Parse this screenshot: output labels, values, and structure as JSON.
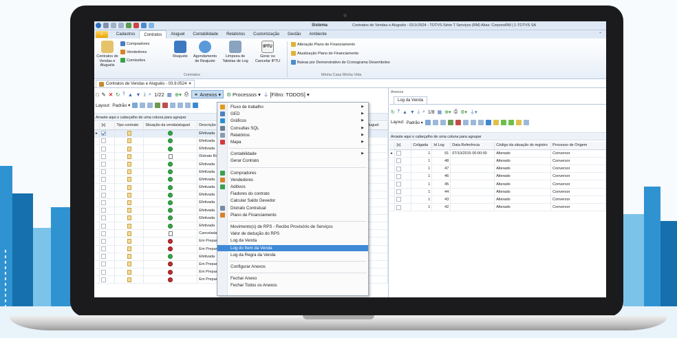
{
  "window": {
    "title": "Sistema",
    "info": "Contratos de Vendas e Aluguéis - 03.9.0524 - TOTVS Série T Serviços (RM) Alias: CorporeRM | 1-TOTVS SA"
  },
  "menu": {
    "tabs": [
      "Cadastros",
      "Contratos",
      "Aluguel",
      "Contabilidade",
      "Relatórios",
      "Customização",
      "Gestão",
      "Ambiente"
    ],
    "active_index": 1
  },
  "ribbon": {
    "big_buttons": [
      {
        "label1": "Contratos de",
        "label2": "Vendas e Aluguéis"
      },
      {
        "label1": "Reajuste",
        "label2": ""
      },
      {
        "label1": "Agendamento",
        "label2": "de Reajuste"
      },
      {
        "label1": "Limpeza de",
        "label2": "Tabelas de Log"
      },
      {
        "label1": "Gerar ou",
        "label2": "Cancelar IPTU"
      }
    ],
    "iptu_icon_text": "IPTU",
    "small_buttons": [
      "Compradores",
      "Vendedores",
      "Comissões"
    ],
    "list_buttons": [
      "Alteração Plano de Financiamento",
      "Atualização Plano de Financiamento",
      "Baixas por Demonstrativo de Cronograma Desembolso"
    ],
    "group_contratos": "Contratos",
    "group_minha_casa": "Minha Casa Minha Vida"
  },
  "doc_tab": "Contratos de Vendas e Aluguéis - 03.9.0524",
  "left": {
    "page_counter": "1/22",
    "anexos": "Anexos",
    "processos": "Processos",
    "filtro": "[Filtro: TODOS]",
    "layout_label": "Layout:",
    "layout_value": "Padrão",
    "group_hint": "Arraste aqui o cabeçalho de uma coluna para agrupar",
    "columns": [
      "[x]",
      "Tipo contrato",
      "Situação da venda/aluguel",
      "Descrição situação",
      "Venda/Aluguel"
    ],
    "rows": [
      {
        "status": "ok",
        "desc": "Efetivada",
        "checked": true
      },
      {
        "status": "ok",
        "desc": "Efetivada",
        "checked": false
      },
      {
        "status": "ok",
        "desc": "Efetivada",
        "checked": false
      },
      {
        "status": "page",
        "desc": "Distrato Bilateral",
        "checked": false
      },
      {
        "status": "ok",
        "desc": "Efetivada",
        "checked": false
      },
      {
        "status": "ok",
        "desc": "Efetivada",
        "checked": false
      },
      {
        "status": "ok",
        "desc": "Efetivada",
        "checked": false
      },
      {
        "status": "ok",
        "desc": "Efetivada",
        "checked": false
      },
      {
        "status": "ok",
        "desc": "Efetivada",
        "checked": false
      },
      {
        "status": "ok",
        "desc": "Efetivada",
        "checked": false
      },
      {
        "status": "ok",
        "desc": "Efetivada",
        "checked": false
      },
      {
        "status": "ok",
        "desc": "Efetivada",
        "checked": false
      },
      {
        "status": "ok",
        "desc": "Efetivada",
        "checked": false
      },
      {
        "status": "page",
        "desc": "Cancelada",
        "checked": false
      },
      {
        "status": "bad",
        "desc": "Em Preparação",
        "checked": false
      },
      {
        "status": "bad",
        "desc": "Em Preparação",
        "checked": false
      },
      {
        "status": "ok",
        "desc": "Efetivada",
        "checked": false
      },
      {
        "status": "bad",
        "desc": "Em Preparação",
        "checked": false
      },
      {
        "status": "bad",
        "desc": "Em Preparação",
        "checked": false
      },
      {
        "status": "bad",
        "desc": "Em Preparação",
        "checked": false
      }
    ]
  },
  "dropdown": {
    "items": [
      {
        "label": "Fluxo de trabalho",
        "icon": "workflow-icon",
        "arrow": true,
        "color": "#e09a1b"
      },
      {
        "label": "GED",
        "icon": "ged-icon",
        "arrow": true,
        "color": "#4f7fc1"
      },
      {
        "label": "Gráficos",
        "icon": "chart-icon",
        "arrow": true,
        "color": "#2d8fd3"
      },
      {
        "label": "Consultas SQL",
        "icon": "sql-icon",
        "arrow": true,
        "color": "#6a7d93"
      },
      {
        "label": "Relatórios",
        "icon": "report-icon",
        "arrow": true,
        "color": "#8a9bb0"
      },
      {
        "label": "Mapa",
        "icon": "map-pin-icon",
        "arrow": true,
        "color": "#d13a3a"
      },
      {
        "sep": true
      },
      {
        "label": "Contabilidade",
        "arrow": true
      },
      {
        "label": "Gerar Contrato"
      },
      {
        "sep": true
      },
      {
        "label": "Compradores",
        "icon": "buyers-icon",
        "color": "#3aa14b"
      },
      {
        "label": "Vendedores",
        "icon": "sellers-icon",
        "color": "#d9822b"
      },
      {
        "label": "Aditivos",
        "icon": "addendum-icon",
        "color": "#3aa14b"
      },
      {
        "label": "Fiadores do contrato"
      },
      {
        "label": "Calcular Saldo Devedor"
      },
      {
        "label": "Distrato Contratual",
        "icon": "document-icon",
        "color": "#7a8aa0"
      },
      {
        "label": "Plano de Financiamento",
        "icon": "finance-icon",
        "color": "#d9822b"
      },
      {
        "sep": true
      },
      {
        "label": "Movimento(s) de RPS - Recibo Provisório de Serviços"
      },
      {
        "label": "Valor de dedução do RPS"
      },
      {
        "label": "Log da Venda"
      },
      {
        "label": "Log do Item da Venda",
        "highlight": true
      },
      {
        "label": "Log da Regra da Venda"
      },
      {
        "sep": true
      },
      {
        "label": "Configurar Anexos"
      },
      {
        "sep": true
      },
      {
        "label": "Fechar Anexo"
      },
      {
        "label": "Fechar Todos os Anexos"
      }
    ]
  },
  "right": {
    "title": "Anexos",
    "tab": "Log da Venda",
    "page_counter": "1/8",
    "layout_label": "Layout:",
    "layout_value": "Padrão",
    "group_hint": "Arraste aqui o cabeçalho de uma coluna para agrupar",
    "columns": [
      "[x]",
      "Coligada",
      "Id Log",
      "Data Referência",
      "Código da situação do registro",
      "Processo de Origem"
    ],
    "rows": [
      {
        "coligada": "1",
        "idlog": "91",
        "data": "07/10/2015 00:00:00",
        "codigo": "Alterado",
        "processo": "Conversor"
      },
      {
        "coligada": "1",
        "idlog": "48",
        "data": "",
        "codigo": "Alterado",
        "processo": "Conversor"
      },
      {
        "coligada": "1",
        "idlog": "47",
        "data": "",
        "codigo": "Alterado",
        "processo": "Conversor"
      },
      {
        "coligada": "1",
        "idlog": "46",
        "data": "",
        "codigo": "Alterado",
        "processo": "Conversor"
      },
      {
        "coligada": "1",
        "idlog": "45",
        "data": "",
        "codigo": "Alterado",
        "processo": "Conversor"
      },
      {
        "coligada": "1",
        "idlog": "44",
        "data": "",
        "codigo": "Alterado",
        "processo": "Conversor"
      },
      {
        "coligada": "1",
        "idlog": "43",
        "data": "",
        "codigo": "Alterado",
        "processo": "Conversor"
      },
      {
        "coligada": "1",
        "idlog": "42",
        "data": "",
        "codigo": "Alterado",
        "processo": "Conversor"
      }
    ]
  }
}
